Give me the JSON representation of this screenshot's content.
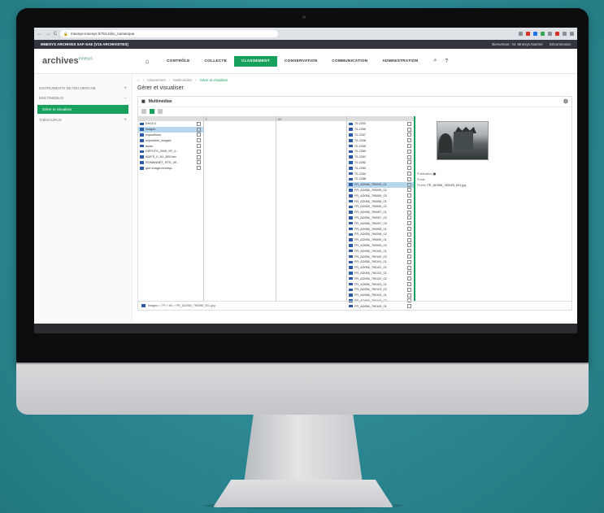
{
  "browser": {
    "url": "mnesys-mnesys.fr/?id=bloc_numerique",
    "nav": [
      "←",
      "→",
      "C"
    ]
  },
  "topbar": {
    "title": "MNESYS ARCHIVES SAF-SAE (V15 ARCHIVISTES)",
    "welcome": "Bienvenue : M. Mnesys Nanmé",
    "logout": "Déconnexion"
  },
  "logo": {
    "text": "archives",
    "sup": "mnesys"
  },
  "menu": {
    "items": [
      "CONTRÔLE",
      "COLLECTE",
      "CLASSEMENT",
      "CONSERVATION",
      "COMMUNICATION",
      "ADMINISTRATION"
    ],
    "active": "CLASSEMENT"
  },
  "sidebar": {
    "items": [
      {
        "label": "INSTRUMENTS DE RECHERCHE",
        "sign": "+"
      },
      {
        "label": "MULTIMÉDIAS",
        "sign": "−"
      },
      {
        "label": "THÉSAURUS",
        "sign": "+"
      }
    ],
    "sub": "Gérer et visualiser"
  },
  "breadcrumb": [
    "Classement",
    "Multimédias",
    "Gérer et visualiser"
  ],
  "page_title": "Gérer et visualiser",
  "panel_title": "Multimédias",
  "col1": {
    "header": "",
    "rows": [
      "ExtCLU",
      "images",
      "expositions",
      "exposition_images",
      "audio",
      "DEPOTS_2009_SF_0..",
      "ADIFS_0_N1_B00.tab",
      "ROMANNET_RTS_VE..",
      "que-image-mnesys.."
    ]
  },
  "col2": {
    "header": "F"
  },
  "col3": {
    "header": "60"
  },
  "col4": {
    "rows": [
      "70-2200",
      "70-2260",
      "70-2267",
      "70-2268",
      "70-2269",
      "70-2280",
      "70-2281",
      "70-2282",
      "70-2283",
      "70-2284",
      "70-2288",
      "FR_AD056_7fi0095_01",
      "FR_AD056_7fi0095_02",
      "FR_AD056_7fi0095_03",
      "FR_AD056_7fi0096_01",
      "FR_AD056_7fi0096_02",
      "FR_AD056_7fi0097_01",
      "FR_AD056_7fi0097_02",
      "FR_AD056_7fi0097_03",
      "FR_AD056_7fi0098_01",
      "FR_AD056_7fi0098_02",
      "FR_AD056_7fi0099_01",
      "FR_AD056_7fi0099_02",
      "FR_AD056_7fi0100_01",
      "FR_AD056_7fi0100_02",
      "FR_AD056_7fi0101_01",
      "FR_AD056_7fi0101_02",
      "FR_AD056_7fi0102_01",
      "FR_AD056_7fi0102_02",
      "FR_AD056_7fi0103_01",
      "FR_AD056_7fi0103_02",
      "FR_AD056_7fi0104_01",
      "FR_AD056_7fi0104_02",
      "FR_AD056_7fi0105_01"
    ],
    "selected": 11
  },
  "preview": {
    "publication_label": "Publication",
    "publication_value": "",
    "poids_label": "Poids",
    "fichier_label": "Fichier",
    "fichier_value": "FR_AD056_7fi0095_001.jpg"
  },
  "status_path": "images > 7Fi > 60 > FR_AD056_7fi0095_001.jpg"
}
